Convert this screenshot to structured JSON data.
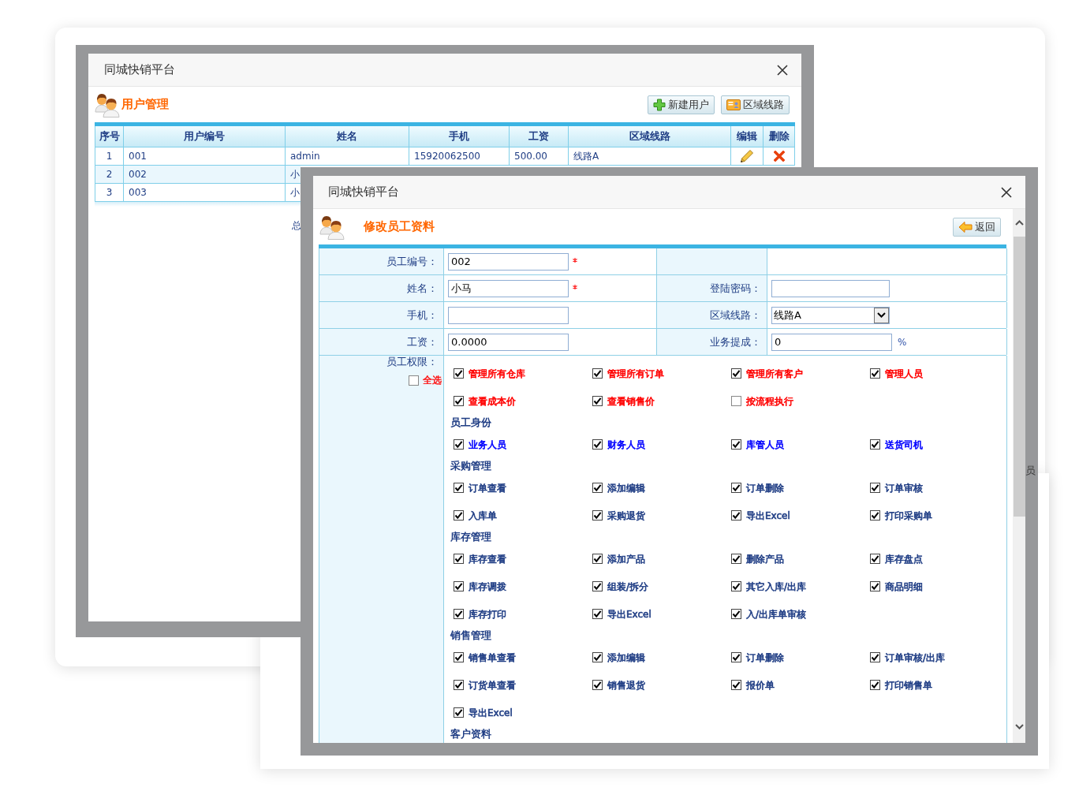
{
  "back_window": {
    "title": "同城快销平台",
    "heading": "用户管理",
    "toolbar": [
      {
        "kind": "add",
        "label": "新建用户"
      },
      {
        "kind": "route",
        "label": "区域线路"
      }
    ],
    "table": {
      "columns": [
        "序号",
        "用户编号",
        "姓名",
        "手机",
        "工资",
        "区域线路",
        "编辑",
        "删除"
      ],
      "rows": [
        {
          "cells": [
            "1",
            "001",
            "admin",
            "15920062500",
            "500.00",
            "线路A"
          ]
        },
        {
          "cells": [
            "2",
            "002",
            "小"
          ]
        },
        {
          "cells": [
            "3",
            "003",
            "小"
          ]
        }
      ]
    },
    "footer_text": "总"
  },
  "front_window": {
    "title": "同城快销平台",
    "heading": "修改员工资料",
    "back_button": "返回",
    "form": [
      {
        "left": {
          "label": "员工编号：",
          "kind": "text",
          "value": "002",
          "required": true
        }
      },
      {
        "left": {
          "label": "姓名：",
          "kind": "text",
          "value": "小马",
          "required": true
        },
        "right": {
          "label": "登陆密码：",
          "kind": "password",
          "required": false
        }
      },
      {
        "left": {
          "label": "手机：",
          "kind": "text",
          "required": false
        },
        "right": {
          "label": "区域线路：",
          "kind": "select",
          "value": "线路A",
          "required": false
        }
      },
      {
        "left": {
          "label": "工资：",
          "kind": "text",
          "value": "0.0000",
          "required": false
        },
        "right": {
          "label": "业务提成：",
          "kind": "text",
          "value": "0",
          "suffix": "%",
          "required": false
        }
      }
    ],
    "permissions": {
      "label": "员工权限：",
      "select_all": {
        "label": "全选",
        "checked": false
      },
      "groups": [
        {
          "items": [
            {
              "label": "管理所有仓库",
              "checked": true,
              "color": "#ff0000"
            },
            {
              "label": "管理所有订单",
              "checked": true,
              "color": "#ff0000"
            },
            {
              "label": "管理所有客户",
              "checked": true,
              "color": "#ff0000"
            },
            {
              "label": "管理人员",
              "checked": true,
              "color": "#ff0000"
            },
            {
              "label": "查看成本价",
              "checked": true,
              "color": "#ff0000"
            },
            {
              "label": "查看销售价",
              "checked": true,
              "color": "#ff0000"
            },
            {
              "label": "按流程执行",
              "checked": false,
              "color": "#ff0000"
            }
          ]
        },
        {
          "heading": "员工身份",
          "items": [
            {
              "label": "业务人员",
              "checked": true,
              "color": "#0000ff"
            },
            {
              "label": "财务人员",
              "checked": true,
              "color": "#0000ff"
            },
            {
              "label": "库管人员",
              "checked": true,
              "color": "#0000ff"
            },
            {
              "label": "送货司机",
              "checked": true,
              "color": "#0000ff"
            }
          ]
        },
        {
          "heading": "采购管理",
          "items": [
            {
              "label": "订单查看",
              "checked": true,
              "color": "#1f3d84"
            },
            {
              "label": "添加编辑",
              "checked": true,
              "color": "#1f3d84"
            },
            {
              "label": "订单删除",
              "checked": true,
              "color": "#1f3d84"
            },
            {
              "label": "订单审核",
              "checked": true,
              "color": "#1f3d84"
            },
            {
              "label": "入库单",
              "checked": true,
              "color": "#1f3d84"
            },
            {
              "label": "采购退货",
              "checked": true,
              "color": "#1f3d84"
            },
            {
              "label": "导出Excel",
              "checked": true,
              "color": "#1f3d84"
            },
            {
              "label": "打印采购单",
              "checked": true,
              "color": "#1f3d84"
            }
          ]
        },
        {
          "heading": "库存管理",
          "items": [
            {
              "label": "库存查看",
              "checked": true,
              "color": "#1f3d84"
            },
            {
              "label": "添加产品",
              "checked": true,
              "color": "#1f3d84"
            },
            {
              "label": "删除产品",
              "checked": true,
              "color": "#1f3d84"
            },
            {
              "label": "库存盘点",
              "checked": true,
              "color": "#1f3d84"
            },
            {
              "label": "库存调拨",
              "checked": true,
              "color": "#1f3d84"
            },
            {
              "label": "组装/拆分",
              "checked": true,
              "color": "#1f3d84"
            },
            {
              "label": "其它入库/出库",
              "checked": true,
              "color": "#1f3d84"
            },
            {
              "label": "商品明细",
              "checked": true,
              "color": "#1f3d84"
            },
            {
              "label": "库存打印",
              "checked": true,
              "color": "#1f3d84"
            },
            {
              "label": "导出Excel",
              "checked": true,
              "color": "#1f3d84"
            },
            {
              "label": "入/出库单审核",
              "checked": true,
              "color": "#1f3d84"
            }
          ]
        },
        {
          "heading": "销售管理",
          "items": [
            {
              "label": "销售单查看",
              "checked": true,
              "color": "#1f3d84"
            },
            {
              "label": "添加编辑",
              "checked": true,
              "color": "#1f3d84"
            },
            {
              "label": "订单删除",
              "checked": true,
              "color": "#1f3d84"
            },
            {
              "label": "订单审核/出库",
              "checked": true,
              "color": "#1f3d84"
            },
            {
              "label": "订货单查看",
              "checked": true,
              "color": "#1f3d84"
            },
            {
              "label": "销售退货",
              "checked": true,
              "color": "#1f3d84"
            },
            {
              "label": "报价单",
              "checked": true,
              "color": "#1f3d84"
            },
            {
              "label": "打印销售单",
              "checked": true,
              "color": "#1f3d84"
            },
            {
              "label": "导出Excel",
              "checked": true,
              "color": "#1f3d84"
            }
          ]
        },
        {
          "heading": "客户资料"
        }
      ]
    }
  },
  "backdrop_text": "员"
}
